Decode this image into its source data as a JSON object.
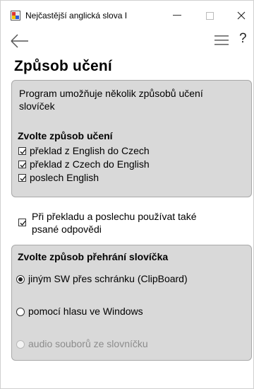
{
  "window": {
    "title": "Nejčastější anglická slova I",
    "minimize_glyph": "—",
    "maximize_glyph": "☐",
    "close_glyph": "✕",
    "icon": "app-icon"
  },
  "toolbar": {
    "back_icon": "arrow-left-icon",
    "menu_icon": "hamburger-menu-icon",
    "help_label": "?"
  },
  "page": {
    "title": "Způsob učení"
  },
  "learning_panel": {
    "intro": [
      "Program umožňuje několik způsobů učení",
      "slovíček"
    ],
    "heading": "Zvolte způsob učení",
    "options": [
      {
        "label": "překlad z English do Czech",
        "checked": true
      },
      {
        "label": "překlad z Czech do English",
        "checked": true
      },
      {
        "label": "poslech English",
        "checked": true
      }
    ]
  },
  "written_answers": {
    "label_lines": [
      "Při překladu a poslechu používat také",
      "psané odpovědi"
    ],
    "checked": true
  },
  "playback_panel": {
    "heading": "Zvolte způsob přehrání slovíčka",
    "options": [
      {
        "label": "jiným SW přes schránku (ClipBoard)",
        "selected": true,
        "enabled": true
      },
      {
        "label": "pomocí hlasu ve Windows",
        "selected": false,
        "enabled": true
      },
      {
        "label": "audio souborů ze slovníčku",
        "selected": false,
        "enabled": false
      }
    ]
  }
}
